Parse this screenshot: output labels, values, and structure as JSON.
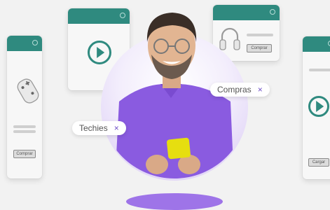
{
  "tags": {
    "compras": {
      "label": "Compras",
      "close": "×"
    },
    "techies": {
      "label": "Techies",
      "close": "×"
    }
  },
  "cards": {
    "gamepad": {
      "button": "Comprar",
      "icon": "gamepad-icon"
    },
    "video_top": {
      "icon": "play-icon"
    },
    "headphones": {
      "button": "Comprar",
      "icon": "headphones-icon"
    },
    "video_right": {
      "button": "Cargar",
      "icon": "play-icon"
    }
  },
  "colors": {
    "accent": "#2f8a7f",
    "purple": "#8a5be0",
    "tag_close": "#6d4ec6"
  }
}
